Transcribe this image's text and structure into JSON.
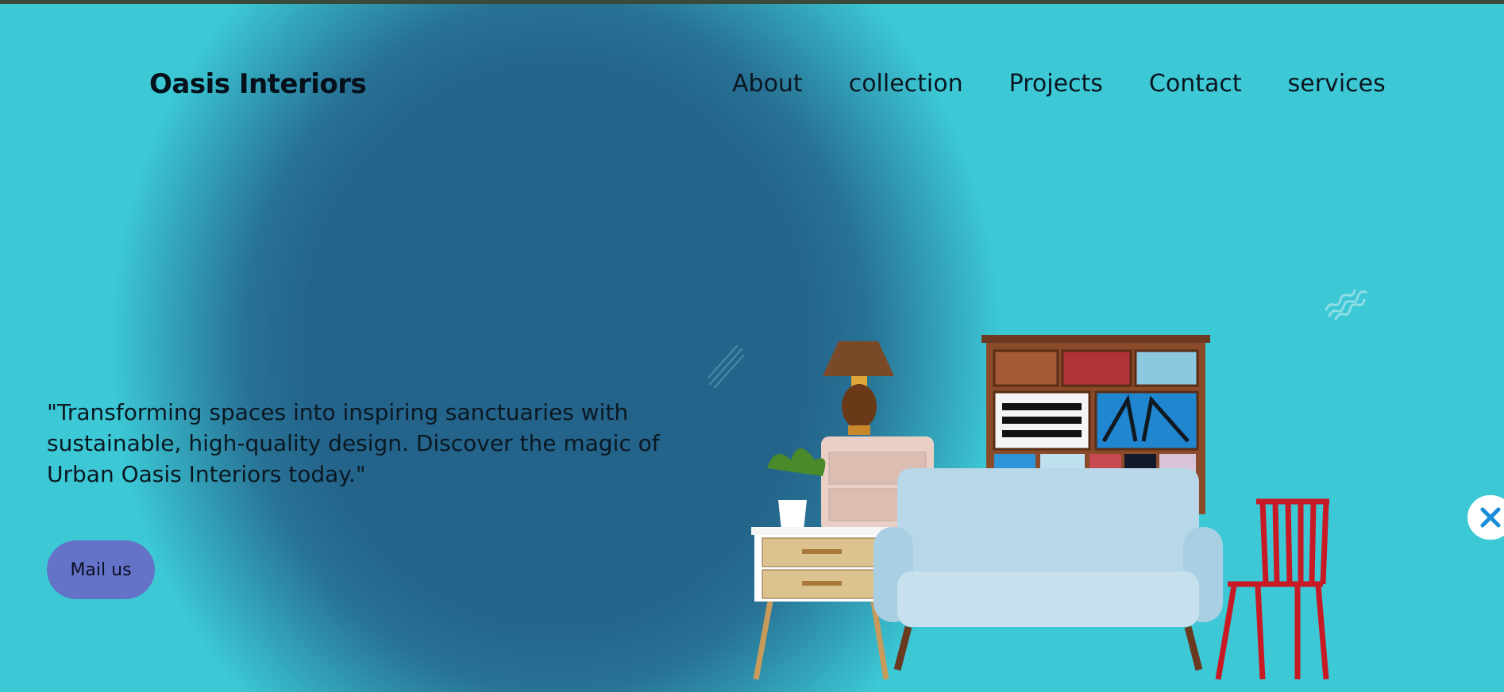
{
  "brand": {
    "name": "Oasis Interiors"
  },
  "nav": {
    "items": [
      {
        "label": "About"
      },
      {
        "label": "collection"
      },
      {
        "label": "Projects"
      },
      {
        "label": "Contact"
      },
      {
        "label": "services"
      }
    ]
  },
  "hero": {
    "tagline": "\"Transforming spaces into inspiring sanctuaries with sustainable, high-quality design. Discover the magic of Urban Oasis Interiors today.\"",
    "cta_label": "Mail us"
  },
  "colors": {
    "background": "#3cc8d5",
    "glow": "#24638a",
    "cta": "#6472c8",
    "topbar": "#3a4a3a"
  },
  "icons": {
    "floating": "x-logo-icon",
    "decor": "squiggle-lines-icon"
  }
}
